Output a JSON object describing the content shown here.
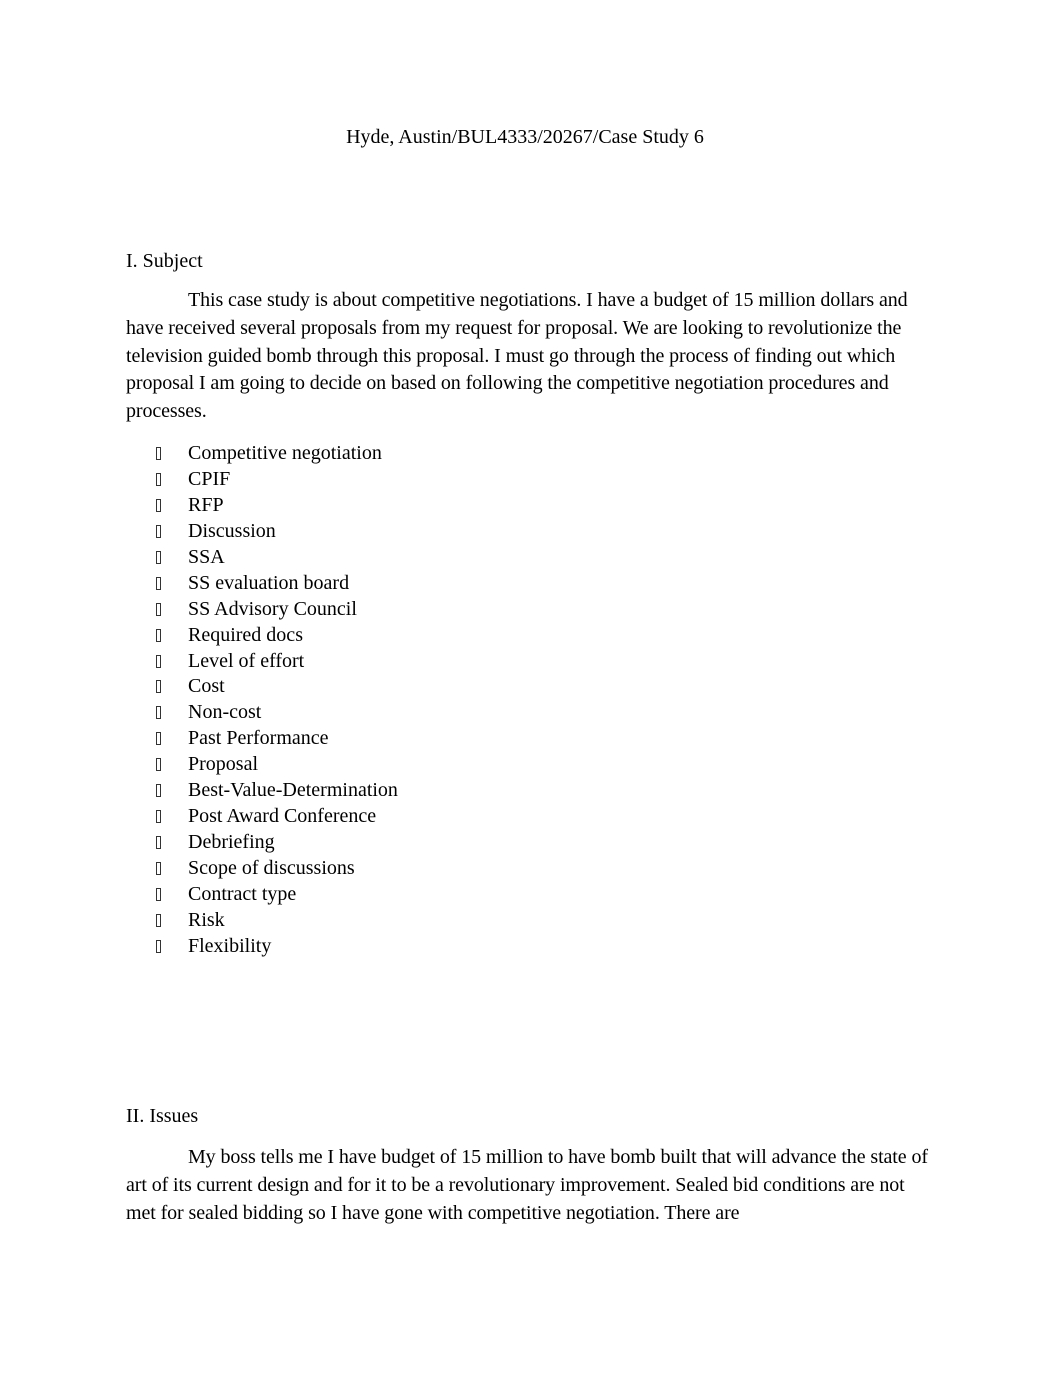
{
  "document": {
    "header": "Hyde, Austin/BUL4333/20267/Case Study 6",
    "sections": [
      {
        "heading": "I. Subject",
        "paragraph": "This case study is about competitive negotiations. I have a budget of 15 million dollars and have received several proposals from my request for proposal. We are looking to revolutionize the television guided bomb through this proposal. I must go through the process of finding out which proposal I am going to decide on based on following the competitive negotiation procedures and processes.",
        "bullet_icon": "missing-glyph-box",
        "bullets": [
          "Competitive negotiation",
          "CPIF",
          "RFP",
          "Discussion",
          "SSA",
          "SS evaluation board",
          "SS Advisory Council",
          "Required docs",
          "Level of effort",
          "Cost",
          "Non-cost",
          "Past Performance",
          "Proposal",
          "Best-Value-Determination",
          "Post Award Conference",
          "Debriefing",
          "Scope of discussions",
          "Contract type",
          "Risk",
          "Flexibility"
        ]
      },
      {
        "heading": "II. Issues",
        "paragraph": "My boss tells me I have budget of 15 million to have bomb built that will advance the state of art of its current design and for it to be a revolutionary improvement. Sealed bid conditions are not met for sealed bidding so I have gone with competitive negotiation. There are"
      }
    ]
  }
}
